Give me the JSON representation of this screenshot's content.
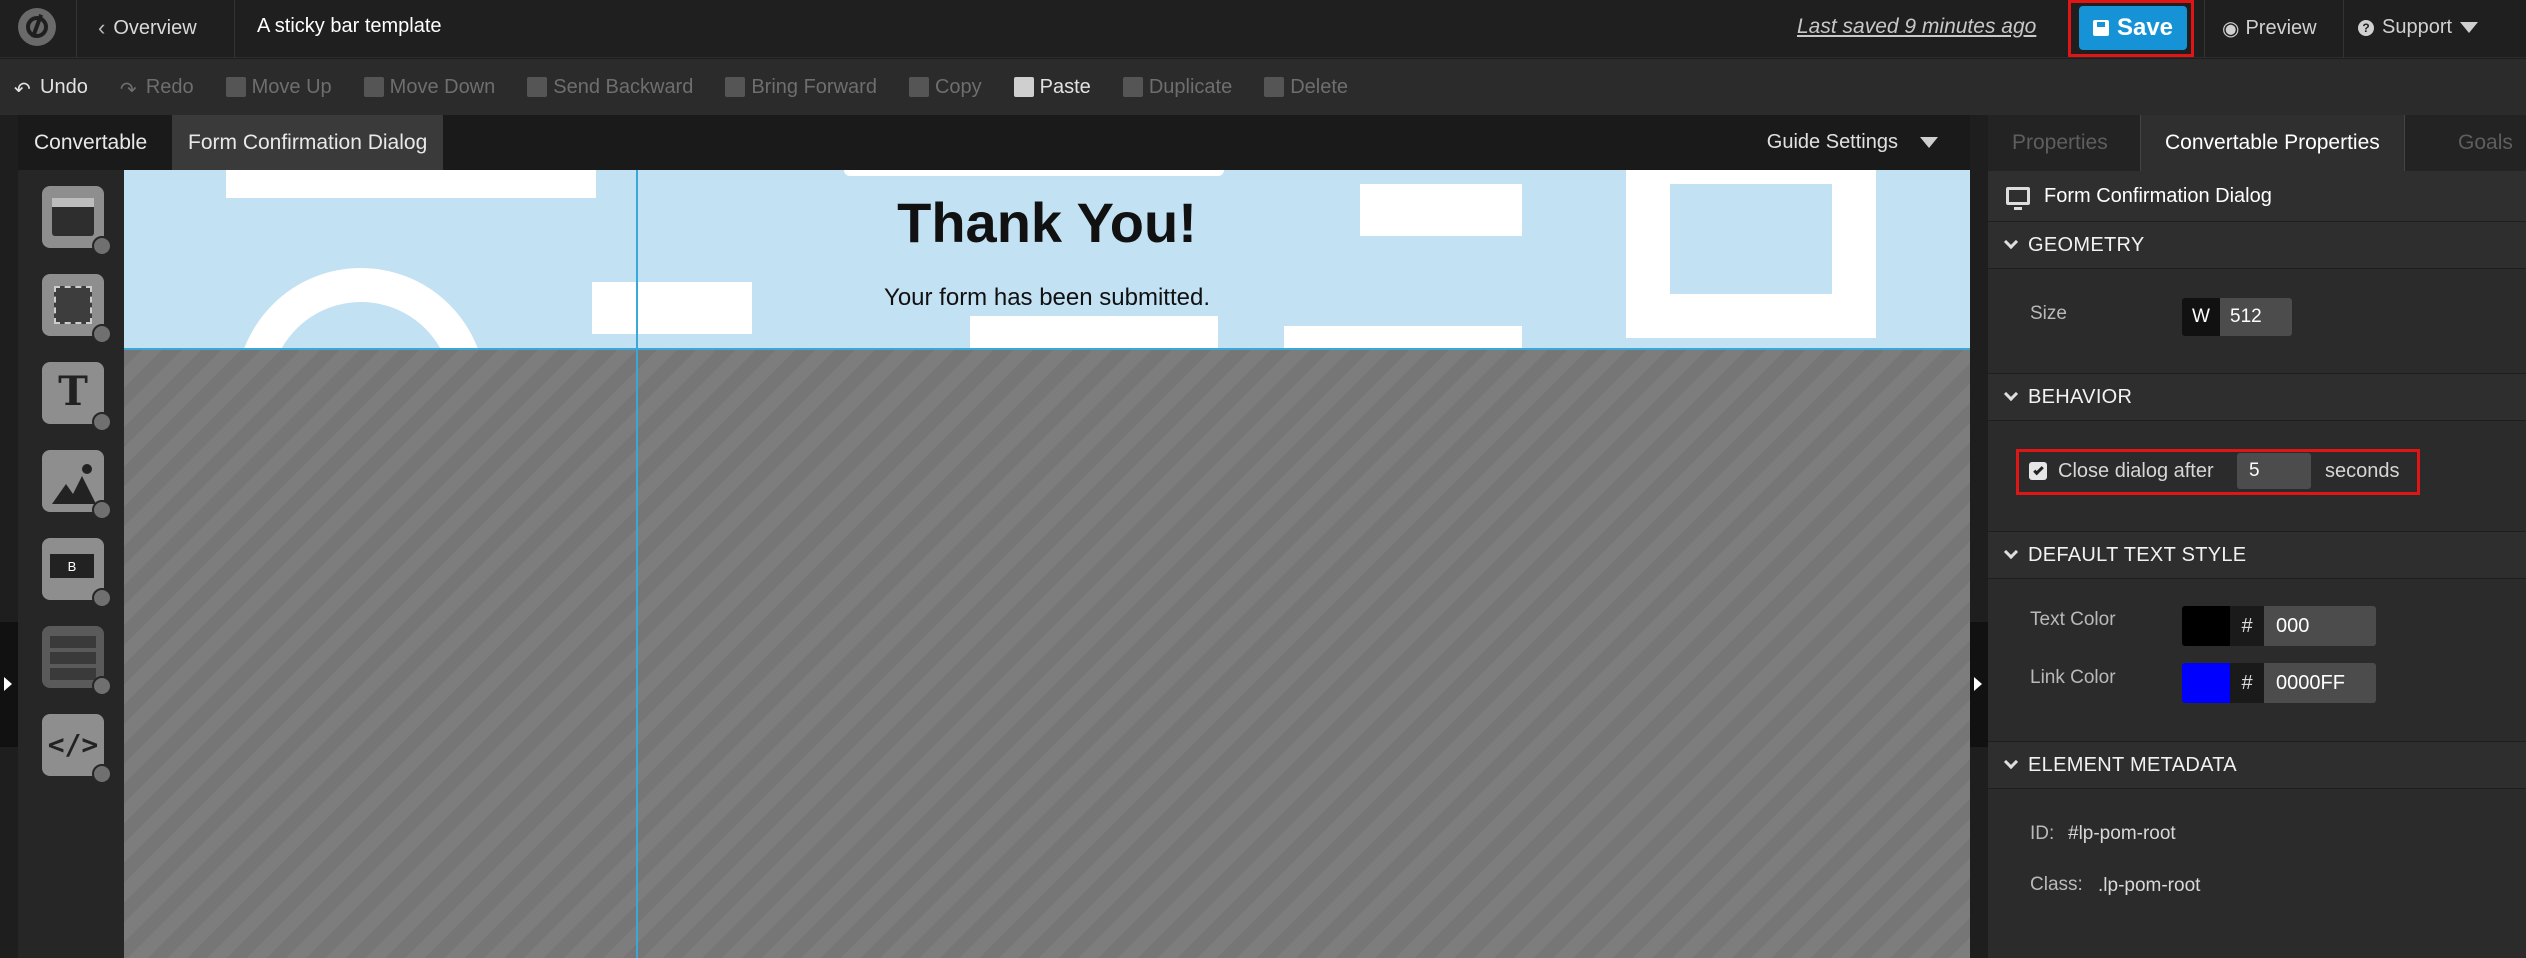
{
  "header": {
    "back_label": "Overview",
    "page_title": "A sticky bar template",
    "last_saved": "Last saved  9 minutes ago",
    "save_label": "Save",
    "preview_label": "Preview",
    "support_label": "Support"
  },
  "toolbar": {
    "items": [
      {
        "label": "Undo",
        "icon": "undo-icon",
        "enabled": true
      },
      {
        "label": "Redo",
        "icon": "redo-icon",
        "enabled": false
      },
      {
        "label": "Move Up",
        "icon": "move-up-icon",
        "enabled": false
      },
      {
        "label": "Move Down",
        "icon": "move-down-icon",
        "enabled": false
      },
      {
        "label": "Send Backward",
        "icon": "send-backward-icon",
        "enabled": false
      },
      {
        "label": "Bring Forward",
        "icon": "bring-forward-icon",
        "enabled": false
      },
      {
        "label": "Copy",
        "icon": "copy-icon",
        "enabled": false
      },
      {
        "label": "Paste",
        "icon": "paste-icon",
        "enabled": true
      },
      {
        "label": "Duplicate",
        "icon": "duplicate-icon",
        "enabled": false
      },
      {
        "label": "Delete",
        "icon": "delete-icon",
        "enabled": false
      }
    ]
  },
  "editor": {
    "tabs": [
      {
        "label": "Convertable"
      },
      {
        "label": "Form Confirmation Dialog"
      }
    ],
    "guide_settings_label": "Guide Settings",
    "widgets": [
      "section-widget-icon",
      "box-widget-icon",
      "text-widget-icon",
      "image-widget-icon",
      "button-widget-icon",
      "form-widget-icon",
      "custom-html-widget-icon"
    ],
    "dialog": {
      "heading": "Thank You!",
      "subtext": "Your form has been submitted."
    }
  },
  "panel": {
    "tabs": [
      {
        "label": "Properties"
      },
      {
        "label": "Convertable Properties"
      },
      {
        "label": "Goals"
      }
    ],
    "element_title": "Form Confirmation Dialog",
    "geometry": {
      "section_label": "GEOMETRY",
      "size_label": "Size",
      "w_label": "W",
      "width_value": "512"
    },
    "behavior": {
      "section_label": "BEHAVIOR",
      "close_label": "Close dialog after",
      "close_seconds": "5",
      "seconds_label": "seconds",
      "checked": true
    },
    "text_style": {
      "section_label": "DEFAULT TEXT STYLE",
      "text_color_label": "Text Color",
      "text_color": "000",
      "link_color_label": "Link Color",
      "link_color": "0000FF",
      "hash": "#"
    },
    "metadata": {
      "section_label": "ELEMENT METADATA",
      "id_label": "ID:",
      "id_value": "#lp-pom-root",
      "class_label": "Class:",
      "class_value": ".lp-pom-root"
    }
  },
  "colors": {
    "save_button": "#1593d6",
    "highlight": "#e01515",
    "dialog_bg": "#c2e1f3",
    "text_color_swatch": "#000000",
    "link_color_swatch": "#0000ff"
  }
}
